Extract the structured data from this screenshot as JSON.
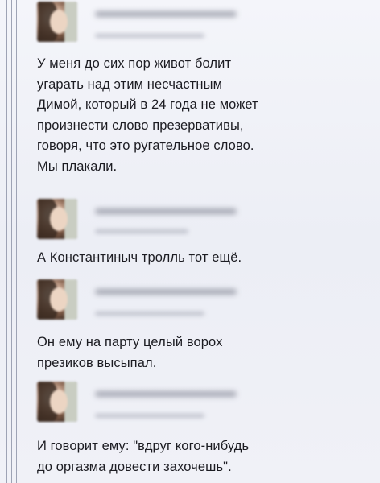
{
  "messages": [
    {
      "lines": [
        "У меня до сих пор живот болит",
        "угарать над этим несчастным",
        "Димой, который в 24 года не может",
        "произнести слово презервативы,",
        "говоря, что это ругательное слово.",
        "Мы плакали."
      ]
    },
    {
      "lines": [
        "А Константиныч тролль тот ещё."
      ]
    },
    {
      "lines": [
        "Он ему на парту целый ворох",
        "презиков высыпал."
      ]
    },
    {
      "lines": [
        "И говорит ему: \"вдруг кого-нибудь",
        "до оргазма довести захочешь\"."
      ]
    }
  ]
}
